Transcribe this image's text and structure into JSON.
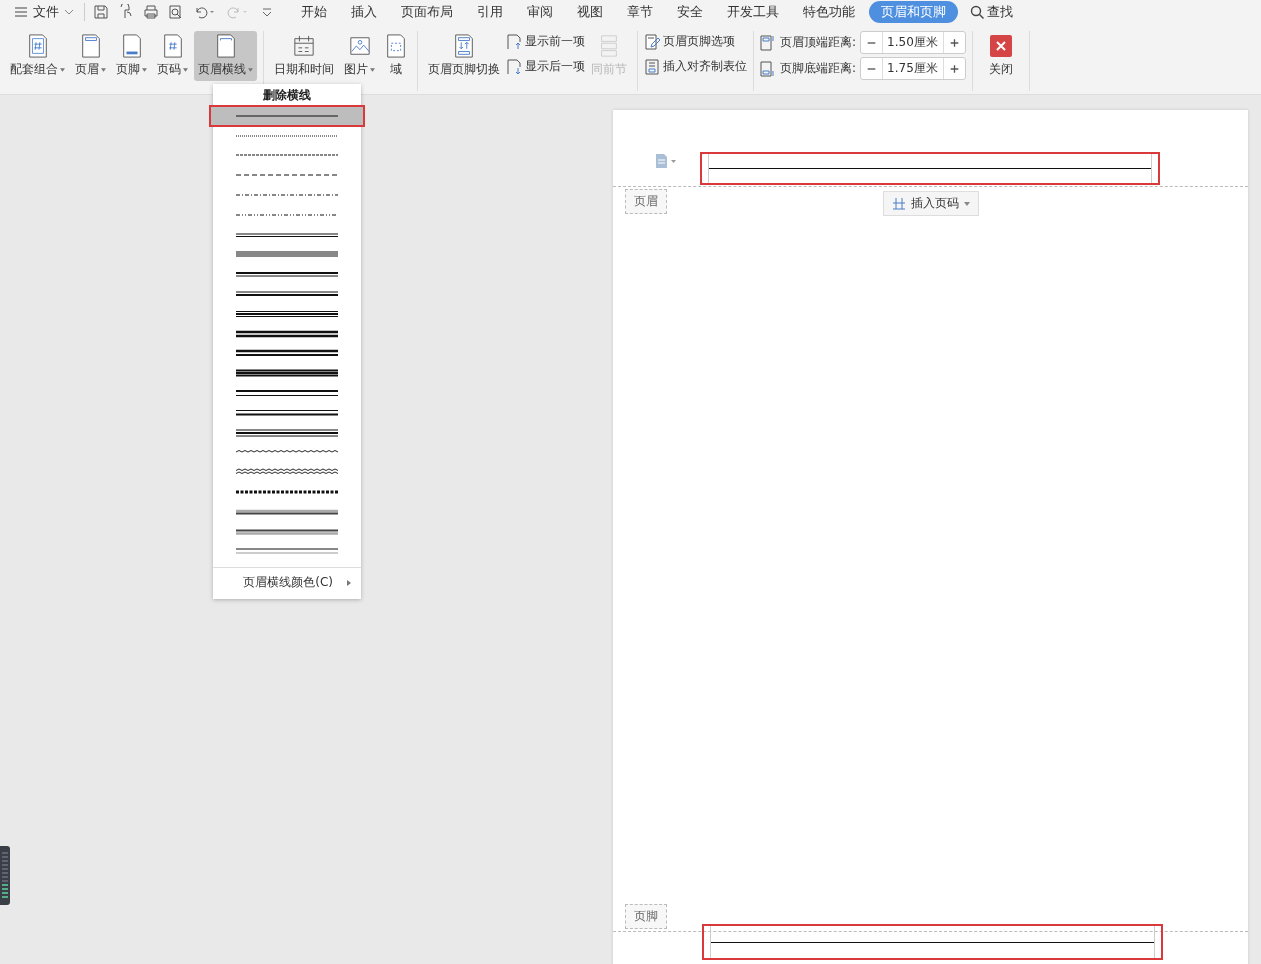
{
  "menu_bar": {
    "file_menu": "文件",
    "tabs": [
      {
        "label": "开始",
        "selected": false
      },
      {
        "label": "插入",
        "selected": false
      },
      {
        "label": "页面布局",
        "selected": false
      },
      {
        "label": "引用",
        "selected": false
      },
      {
        "label": "审阅",
        "selected": false
      },
      {
        "label": "视图",
        "selected": false
      },
      {
        "label": "章节",
        "selected": false
      },
      {
        "label": "安全",
        "selected": false
      },
      {
        "label": "开发工具",
        "selected": false
      },
      {
        "label": "特色功能",
        "selected": false
      },
      {
        "label": "页眉和页脚",
        "selected": true
      }
    ],
    "search": "查找"
  },
  "ribbon": {
    "header_footer_tools": [
      {
        "label": "配套组合",
        "dropdown": true,
        "selected": false
      },
      {
        "label": "页眉",
        "dropdown": true,
        "selected": false
      },
      {
        "label": "页脚",
        "dropdown": true,
        "selected": false
      },
      {
        "label": "页码",
        "dropdown": true,
        "selected": false
      },
      {
        "label": "页眉横线",
        "dropdown": true,
        "selected": true
      }
    ],
    "insert_tools": [
      {
        "label": "日期和时间",
        "dropdown": false
      },
      {
        "label": "图片",
        "dropdown": true
      },
      {
        "label": "域",
        "dropdown": false
      }
    ],
    "switch_button": "页眉页脚切换",
    "navigation": [
      {
        "label": "显示前一项"
      },
      {
        "label": "显示后一项"
      }
    ],
    "same_as_previous": {
      "label": "同前节",
      "disabled": true
    },
    "options": [
      {
        "label": "页眉页脚选项"
      },
      {
        "label": "插入对齐制表位"
      }
    ],
    "distances": [
      {
        "label": "页眉顶端距离:",
        "value": "1.50厘米"
      },
      {
        "label": "页脚底端距离:",
        "value": "1.75厘米"
      }
    ],
    "close": "关闭"
  },
  "line_menu": {
    "remove": "删除横线",
    "styles": [
      {
        "kind": "single",
        "selected": true
      },
      {
        "kind": "dotted",
        "selected": false
      },
      {
        "kind": "dashed",
        "selected": false
      },
      {
        "kind": "longdash",
        "selected": false
      },
      {
        "kind": "dashdot",
        "selected": false
      },
      {
        "kind": "dashdotdot",
        "selected": false
      },
      {
        "kind": "double",
        "selected": false
      },
      {
        "kind": "triple",
        "selected": false
      },
      {
        "kind": "thickthin",
        "selected": false
      },
      {
        "kind": "thinthick",
        "selected": false
      },
      {
        "kind": "thinthickthin",
        "selected": false
      },
      {
        "kind": "thickthick",
        "selected": false
      },
      {
        "kind": "thickthick2",
        "selected": false
      },
      {
        "kind": "triplethick",
        "selected": false
      },
      {
        "kind": "thickthinwide",
        "selected": false
      },
      {
        "kind": "thinthickwide",
        "selected": false
      },
      {
        "kind": "thinthickthinwide",
        "selected": false
      },
      {
        "kind": "wave",
        "selected": false
      },
      {
        "kind": "doublewave",
        "selected": false
      },
      {
        "kind": "striped",
        "selected": false
      },
      {
        "kind": "emboss",
        "selected": false
      },
      {
        "kind": "engrave",
        "selected": false
      },
      {
        "kind": "inset",
        "selected": false
      }
    ],
    "color_item": "页眉横线颜色(C)"
  },
  "page": {
    "header_tag": "页眉",
    "insert_page_number": "插入页码",
    "footer_tag": "页脚"
  }
}
